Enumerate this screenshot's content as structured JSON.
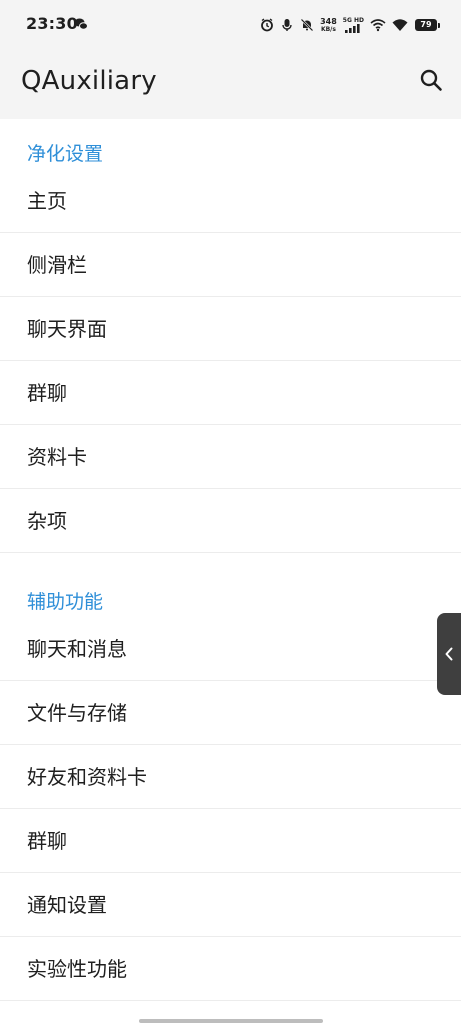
{
  "status_bar": {
    "time": "23:30",
    "net_speed_value": "348",
    "net_speed_unit": "KB/s",
    "signal_tag": "5G HD",
    "battery_level": "79"
  },
  "app_bar": {
    "title": "QAuxiliary",
    "search_icon": "search-icon"
  },
  "sections": [
    {
      "header": "净化设置",
      "items": [
        "主页",
        "侧滑栏",
        "聊天界面",
        "群聊",
        "资料卡",
        "杂项"
      ]
    },
    {
      "header": "辅助功能",
      "items": [
        "聊天和消息",
        "文件与存储",
        "好友和资料卡",
        "群聊",
        "通知设置",
        "实验性功能"
      ]
    }
  ],
  "edge_handle": {
    "icon": "chevron-left-icon"
  },
  "colors": {
    "accent": "#2f8fd8",
    "app_bar_bg": "#f4f4f4",
    "text": "#1f1f1f",
    "divider": "#ececec",
    "edge_handle_bg": "#3f3f3f"
  }
}
